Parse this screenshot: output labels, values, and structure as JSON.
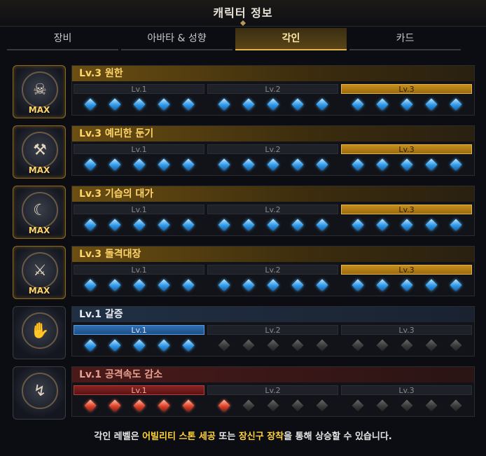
{
  "window": {
    "title": "캐릭터 정보"
  },
  "tabs": [
    {
      "label": "장비",
      "active": false
    },
    {
      "label": "아바타 & 성향",
      "active": false
    },
    {
      "label": "각인",
      "active": true
    },
    {
      "label": "카드",
      "active": false
    }
  ],
  "engravings": [
    {
      "title": "Lv.3 원한",
      "level": 3,
      "max": true,
      "max_label": "MAX",
      "theme": "gold",
      "icon": "demon-face-icon",
      "glyph": "☠"
    },
    {
      "title": "Lv.3 예리한 둔기",
      "level": 3,
      "max": true,
      "max_label": "MAX",
      "theme": "gold",
      "icon": "blunt-weapon-icon",
      "glyph": "⚒"
    },
    {
      "title": "Lv.3 기습의 대가",
      "level": 3,
      "max": true,
      "max_label": "MAX",
      "theme": "gold",
      "icon": "ambush-moon-icon",
      "glyph": "☾"
    },
    {
      "title": "Lv.3 돌격대장",
      "level": 3,
      "max": true,
      "max_label": "MAX",
      "theme": "gold",
      "icon": "charge-warrior-icon",
      "glyph": "⚔"
    },
    {
      "title": "Lv.1 갈증",
      "level": 1,
      "max": false,
      "max_label": "",
      "theme": "blue",
      "icon": "thirst-hand-icon",
      "glyph": "✋"
    },
    {
      "title": "Lv.1 공격속도 감소",
      "level": 1,
      "max": false,
      "max_label": "",
      "theme": "red",
      "icon": "attack-speed-down-icon",
      "glyph": "↯"
    }
  ],
  "engraving_gems": [
    [
      5,
      5,
      5
    ],
    [
      5,
      5,
      5
    ],
    [
      5,
      5,
      5
    ],
    [
      5,
      5,
      5
    ],
    [
      5,
      0,
      0
    ],
    [
      5,
      1,
      0
    ]
  ],
  "level_labels": [
    "Lv.1",
    "Lv.2",
    "Lv.3"
  ],
  "footer": {
    "prefix": "각인 레벨은 ",
    "highlight1": "어빌리티 스톤 세공",
    "middle": " 또는 ",
    "highlight2": "장신구 장착",
    "suffix": "을 통해 상승할 수 있습니다."
  },
  "colors": {
    "gold": "#ffd56a",
    "blue_active": "#2f6fb0",
    "red_active": "#8a2222",
    "highlight": "#ffd23c"
  }
}
